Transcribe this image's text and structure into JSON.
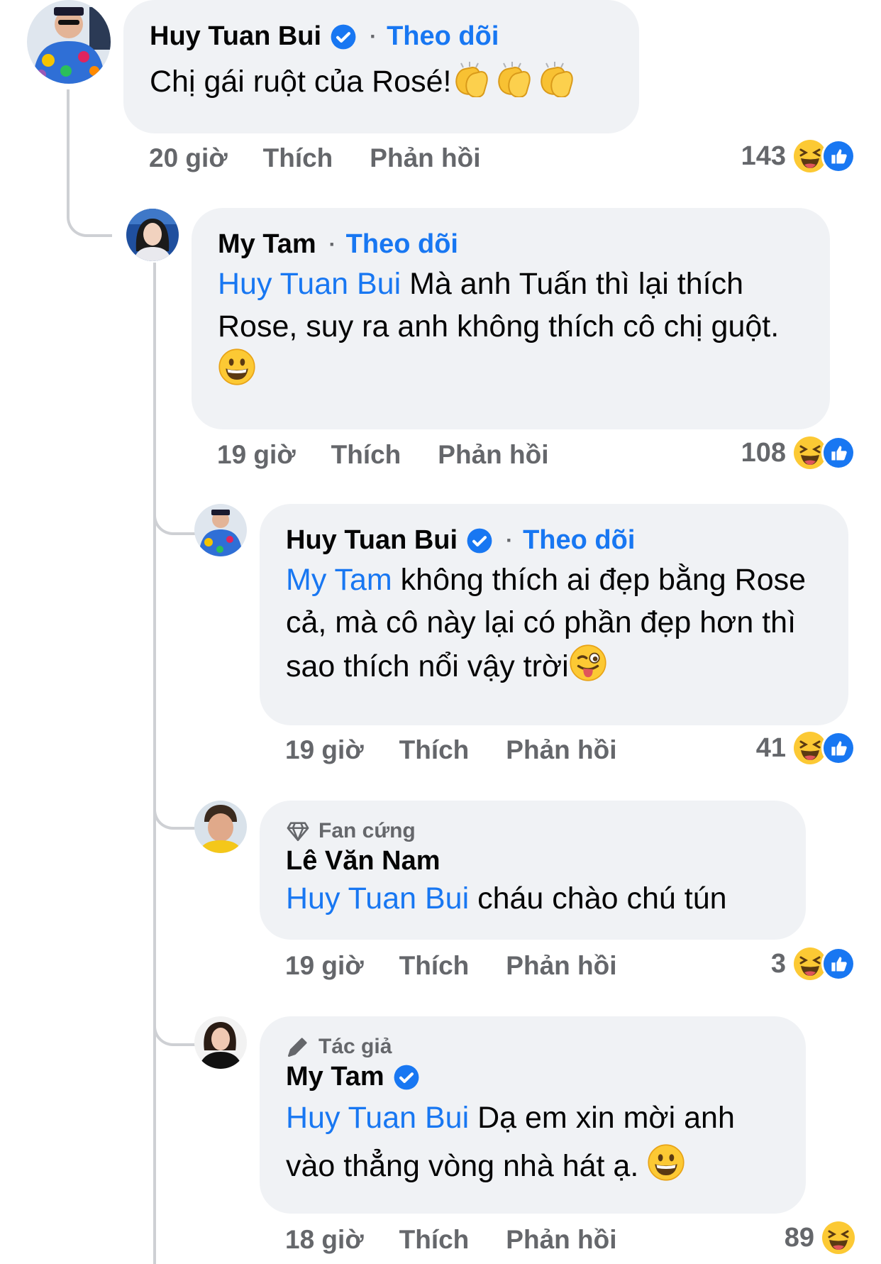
{
  "colors": {
    "link": "#1877f2",
    "bubble": "#f0f2f5",
    "meta": "#65676b",
    "thread": "#ced0d4"
  },
  "comments": [
    {
      "author": "Huy Tuan Bui",
      "verified": true,
      "follow": "Theo dõi",
      "text": "Chị gái ruột của Rosé!",
      "emoji": "clapping-hands x3",
      "time": "20 giờ",
      "like": "Thích",
      "reply": "Phản hồi",
      "reactions": "143"
    },
    {
      "author": "My Tam",
      "verified": false,
      "follow": "Theo dõi",
      "mention": "Huy Tuan Bui",
      "text": " Mà anh Tuấn thì lại thích Rose, suy ra anh không thích cô chị guột.",
      "emoji": "grinning-face",
      "time": "19 giờ",
      "like": "Thích",
      "reply": "Phản hồi",
      "reactions": "108"
    },
    {
      "author": "Huy Tuan Bui",
      "verified": true,
      "follow": "Theo dõi",
      "mention": "My Tam",
      "text": " không thích ai đẹp bằng Rose cả, mà cô này lại có phần đẹp hơn thì sao thích nổi vậy trời",
      "emoji": "winking-face-tongue",
      "time": "19 giờ",
      "like": "Thích",
      "reply": "Phản hồi",
      "reactions": "41"
    },
    {
      "badge": "Fan cứng",
      "badge_icon": "diamond-icon",
      "author": "Lê Văn Nam",
      "mention": "Huy Tuan Bui",
      "text": " cháu chào chú tún",
      "time": "19 giờ",
      "like": "Thích",
      "reply": "Phản hồi",
      "reactions": "3"
    },
    {
      "badge": "Tác giả",
      "badge_icon": "pen-icon",
      "author": "My Tam",
      "verified": true,
      "mention": "Huy Tuan Bui",
      "text": " Dạ em xin mời anh vào thẳng vòng nhà hát ạ.",
      "emoji": "grinning-face",
      "time": "18 giờ",
      "like": "Thích",
      "reply": "Phản hồi",
      "reactions": "89"
    }
  ]
}
